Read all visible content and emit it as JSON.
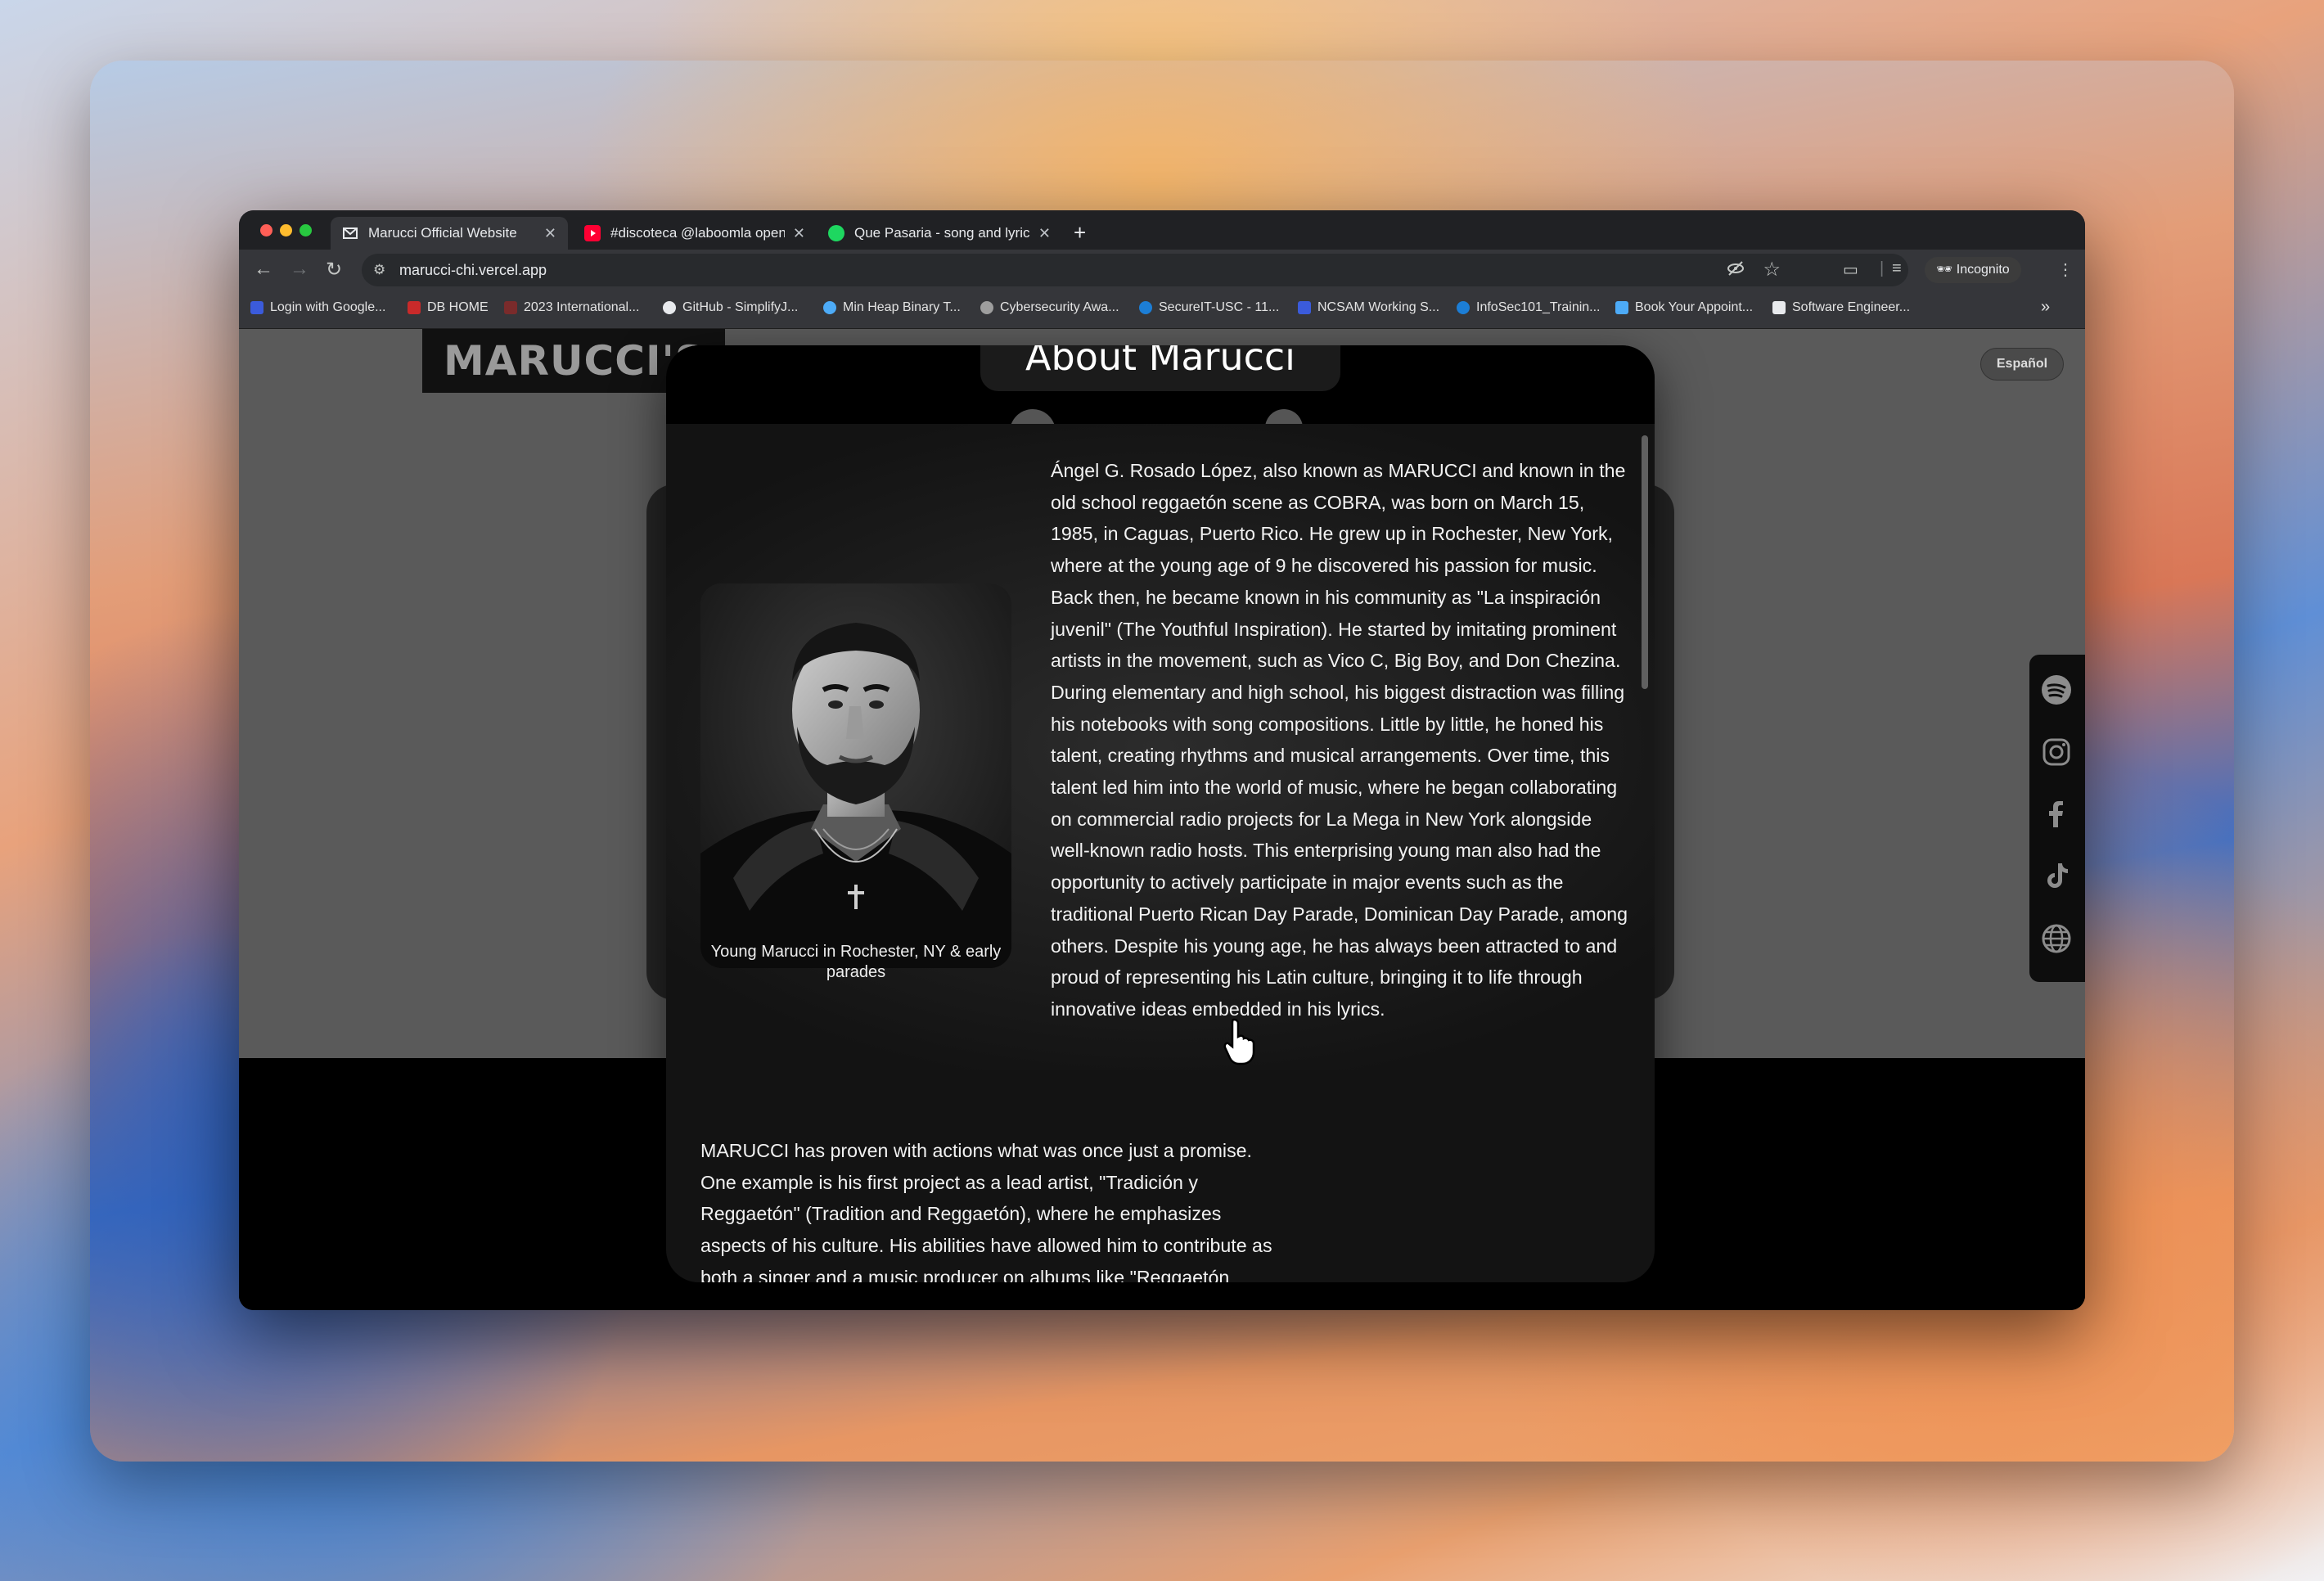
{
  "browser": {
    "tabs": [
      {
        "title": "Marucci Official Website",
        "favicon": "gmail-icon",
        "active": true
      },
      {
        "title": "#discoteca @laboomla openi",
        "favicon": "youtube-icon",
        "active": false
      },
      {
        "title": "Que Pasaria - song and lyrics",
        "favicon": "spotify-icon",
        "active": false
      }
    ],
    "new_tab": "+",
    "url": "marucci-chi.vercel.app",
    "incognito_label": "Incognito",
    "bookmarks": [
      {
        "label": "Login with Google...",
        "color": "#3b5bdb"
      },
      {
        "label": "DB HOME",
        "color": "#c92a2a"
      },
      {
        "label": "2023 International...",
        "color": "#7a2b2b"
      },
      {
        "label": "GitHub - SimplifyJ...",
        "color": "#e8eaed"
      },
      {
        "label": "Min Heap Binary T...",
        "color": "#4dabf7"
      },
      {
        "label": "Cybersecurity Awa...",
        "color": "#9e9e9e"
      },
      {
        "label": "SecureIT-USC - 11...",
        "color": "#1c7ed6"
      },
      {
        "label": "NCSAM Working S...",
        "color": "#3b5bdb"
      },
      {
        "label": "InfoSec101_Trainin...",
        "color": "#1c7ed6"
      },
      {
        "label": "Book Your Appoint...",
        "color": "#4dabf7"
      },
      {
        "label": "Software Engineer...",
        "color": "#e8eaed"
      }
    ],
    "more_bookmarks": "»"
  },
  "page": {
    "story_header": "MARUCCI'S STORY",
    "lang_button": "Español",
    "social_icons": [
      "spotify-icon",
      "instagram-icon",
      "facebook-icon",
      "tiktok-icon",
      "globe-icon"
    ]
  },
  "modal": {
    "title": "About Marucci",
    "photo_caption": "Young Marucci in Rochester, NY & early parades",
    "bio_paragraph_1": "Ángel G. Rosado López, also known as MARUCCI and known in the old school reggaetón scene as COBRA, was born on March 15, 1985, in Caguas, Puerto Rico. He grew up in Rochester, New York, where at the young age of 9 he discovered his passion for music. Back then, he became known in his community as \"La inspiración juvenil\" (The Youthful Inspiration). He started by imitating prominent artists in the movement, such as Vico C, Big Boy, and Don Chezina. During elementary and high school, his biggest distraction was filling his notebooks with song compositions. Little by little, he honed his talent, creating rhythms and musical arrangements. Over time, this talent led him into the world of music, where he began collaborating on commercial radio projects for La Mega in New York alongside well-known radio hosts. This enterprising young man also had the opportunity to actively participate in major events such as the traditional Puerto Rican Day Parade, Dominican Day Parade, among others. Despite his young age, he has always been attracted to and proud of representing his Latin culture, bringing it to life through innovative ideas embedded in his lyrics.",
    "bio_paragraph_2": "MARUCCI has proven with actions what was once just a promise. One example is his first project as a lead artist, \"Tradición y Reggaetón\" (Tradition and Reggaetón), where he emphasizes aspects of his culture. His abilities have allowed him to contribute as both a singer and a music producer on albums like \"Reggaetón"
  }
}
